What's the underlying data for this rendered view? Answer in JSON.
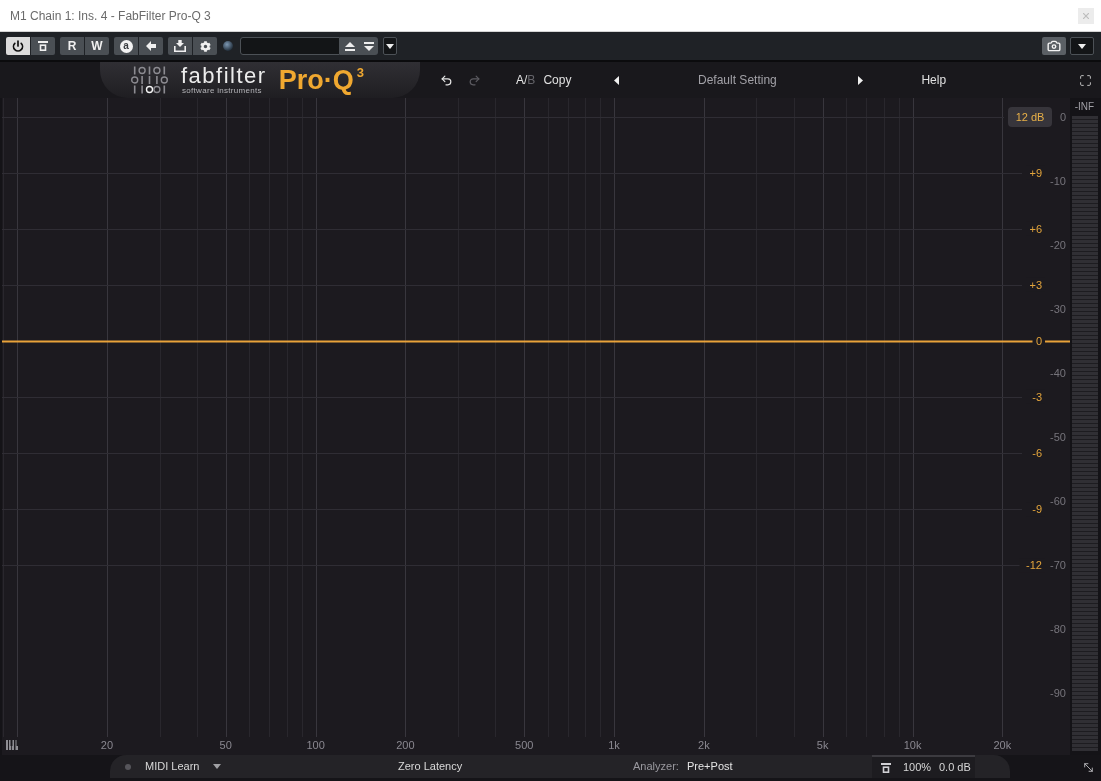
{
  "window": {
    "title": "M1 Chain 1: Ins. 4 - FabFilter Pro-Q 3"
  },
  "toolbar": {
    "groups": [
      {
        "buttons": [
          {
            "kind": "power",
            "on": true
          },
          {
            "kind": "bypass",
            "on": false
          }
        ]
      },
      {
        "buttons": [
          {
            "kind": "read",
            "label": "R",
            "on": false
          },
          {
            "kind": "write",
            "label": "W",
            "on": false
          }
        ]
      },
      {
        "buttons": [
          {
            "kind": "auto",
            "label": "a",
            "on": false
          },
          {
            "kind": "back",
            "on": false
          }
        ]
      },
      {
        "buttons": [
          {
            "kind": "routing",
            "on": false
          },
          {
            "kind": "settings",
            "on": false
          }
        ]
      }
    ]
  },
  "header": {
    "brand": "fabfilter",
    "tagline": "software instruments",
    "product": "Pro·Q",
    "version": "3",
    "history": [
      {
        "kind": "undo",
        "disabled": false
      },
      {
        "kind": "redo",
        "disabled": true
      }
    ],
    "ab": [
      {
        "label": "A",
        "selected": true
      },
      {
        "label": "B",
        "selected": false
      }
    ],
    "ab_separator": "/",
    "copy": "Copy",
    "preset": "Default Setting",
    "help": "Help"
  },
  "graph": {
    "range": "12 dB",
    "chart_data": {
      "type": "line",
      "log": "x",
      "grid": true,
      "xlim": [
        8.9,
        33700
      ],
      "ylim": [
        -21.2,
        13
      ],
      "y2lim": [
        -96.9,
        3
      ],
      "xticks": [
        {
          "value": 20,
          "label": "20"
        },
        {
          "value": 50,
          "label": "50"
        },
        {
          "value": 100,
          "label": "100"
        },
        {
          "value": 200,
          "label": "200"
        },
        {
          "value": 500,
          "label": "500"
        },
        {
          "value": 1000,
          "label": "1k"
        },
        {
          "value": 2000,
          "label": "2k"
        },
        {
          "value": 5000,
          "label": "5k"
        },
        {
          "value": 10000,
          "label": "10k"
        },
        {
          "value": 20000,
          "label": "20k"
        }
      ],
      "yticks": [
        {
          "value": 9,
          "label": "+9"
        },
        {
          "value": 6,
          "label": "+6"
        },
        {
          "value": 3,
          "label": "+3"
        },
        {
          "value": 0,
          "label": "0"
        },
        {
          "value": -3,
          "label": "-3"
        },
        {
          "value": -6,
          "label": "-6"
        },
        {
          "value": -9,
          "label": "-9"
        },
        {
          "value": -12,
          "label": "-12"
        }
      ],
      "y2ticks": [
        0,
        -10,
        -20,
        -30,
        -40,
        -50,
        -60,
        -70,
        -80,
        -90
      ],
      "series": [
        {
          "color": "#e8a23a",
          "x": [
            8.9,
            33700
          ],
          "values": [
            0,
            0
          ]
        }
      ]
    }
  },
  "meter": {
    "reading": "-INF"
  },
  "bottom_bar": {
    "midi_learn": {
      "label": "MIDI Learn",
      "on": false
    },
    "latency": "Zero Latency",
    "analyzer": {
      "label": "Analyzer:",
      "value": "Pre+Post"
    },
    "output": {
      "scale": "100%",
      "gain": "0.0 dB"
    }
  }
}
